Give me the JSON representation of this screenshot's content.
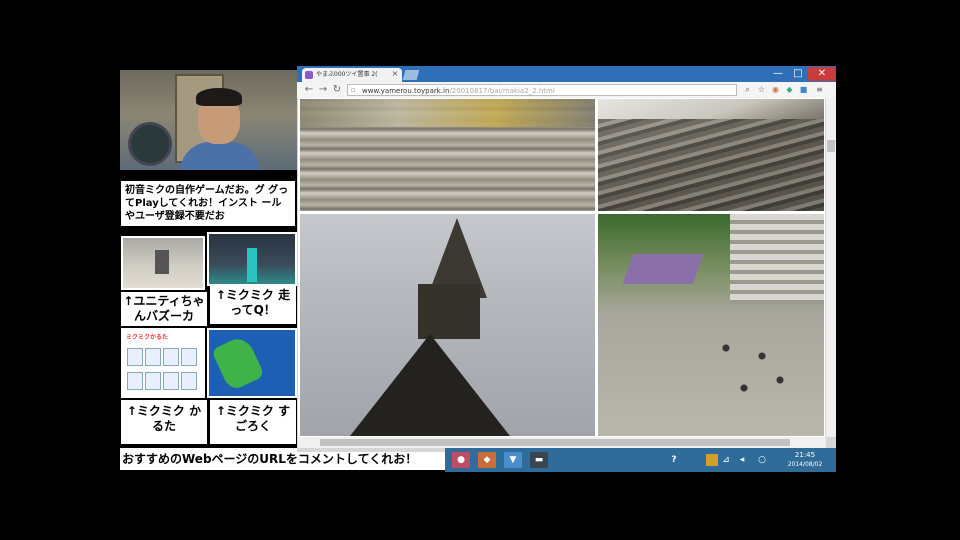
{
  "overlay": {
    "intro_text": "初音ミクの自作ゲームだお。グ グってPlayしてくれお！インスト ールやユーザ登録不要だお",
    "labels": {
      "unity": "↑ユニティちゃ んバズーカ",
      "hashire": "↑ミクミク 走ってQ！",
      "karuta": "↑ミクミク かるた",
      "sugoroku": "↑ミクミク すごろく"
    },
    "karuta_title": "ミクミクかるた",
    "comment_banner": "おすすめのWebページのURLをコメントしてくれお！"
  },
  "browser": {
    "tab_title": "やまぶ000ツイ置事 2(",
    "tab_close": "×",
    "window_controls": {
      "minimize": "—",
      "maximize": "□",
      "close": "✕"
    },
    "nav": {
      "back": "←",
      "forward": "→",
      "reload": "↻"
    },
    "url_main": "www.yamerou.toypark.in",
    "url_path": "/20010817/bai/makia2_2.html",
    "toolbar_icons": [
      "zoom-icon",
      "star-icon",
      "extension-icon",
      "extension-icon",
      "extension-icon",
      "menu-icon"
    ]
  },
  "taskbar": {
    "time": "21:45",
    "date": "2014/08/02",
    "help": "?"
  },
  "colors": {
    "tab_strip": "#2f6fb7",
    "taskbar": "#2f6c99",
    "close_button": "#c83c3c"
  }
}
